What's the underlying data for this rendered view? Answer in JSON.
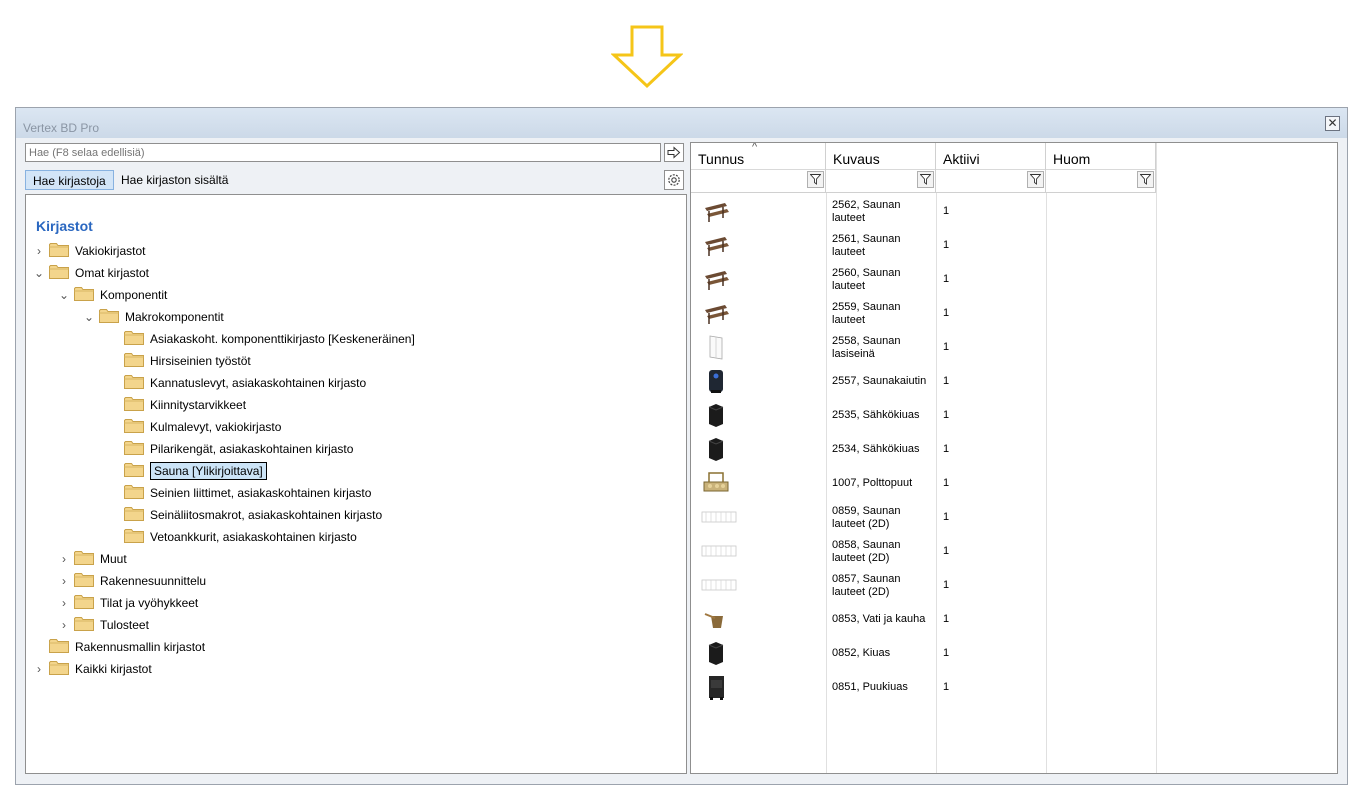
{
  "window": {
    "title": "Vertex BD Pro",
    "close_glyph": "✕"
  },
  "search": {
    "placeholder": "Hae (F8 selaa edellisiä)"
  },
  "tabs": {
    "search_libraries": "Hae kirjastoja",
    "search_library_content": "Hae kirjaston sisältä"
  },
  "tree": {
    "title": "Kirjastot",
    "nodes": [
      {
        "label": "Vakiokirjastot",
        "expander": "›"
      },
      {
        "label": "Omat kirjastot",
        "expander": "⌄"
      },
      {
        "label": "Komponentit",
        "expander": "⌄"
      },
      {
        "label": "Makrokomponentit",
        "expander": "⌄"
      },
      {
        "label": "Asiakaskoht. komponenttikirjasto  [Keskeneräinen]",
        "expander": ""
      },
      {
        "label": "Hirsiseinien työstöt",
        "expander": ""
      },
      {
        "label": "Kannatuslevyt, asiakaskohtainen kirjasto",
        "expander": ""
      },
      {
        "label": "Kiinnitystarvikkeet",
        "expander": ""
      },
      {
        "label": "Kulmalevyt, vakiokirjasto",
        "expander": ""
      },
      {
        "label": "Pilarikengät, asiakaskohtainen kirjasto",
        "expander": ""
      },
      {
        "label": "Sauna  [Ylikirjoittava]",
        "expander": ""
      },
      {
        "label": "Seinien liittimet, asiakaskohtainen kirjasto",
        "expander": ""
      },
      {
        "label": "Seinäliitosmakrot, asiakaskohtainen kirjasto",
        "expander": ""
      },
      {
        "label": "Vetoankkurit, asiakaskohtainen kirjasto",
        "expander": ""
      },
      {
        "label": "Muut",
        "expander": "›"
      },
      {
        "label": "Rakennesuunnittelu",
        "expander": "›"
      },
      {
        "label": "Tilat ja vyöhykkeet",
        "expander": "›"
      },
      {
        "label": "Tulosteet",
        "expander": "›"
      },
      {
        "label": "Rakennusmallin kirjastot",
        "expander": ""
      },
      {
        "label": "Kaikki kirjastot",
        "expander": "›"
      }
    ]
  },
  "grid": {
    "columns": [
      "Tunnus",
      "Kuvaus",
      "Aktiivi",
      "Huom"
    ],
    "sort_indicator": "^",
    "rows": [
      {
        "line1": "2562, Saunan",
        "line2": "lauteet",
        "active": "1",
        "icon": "bench-icon"
      },
      {
        "line1": "2561, Saunan",
        "line2": "lauteet",
        "active": "1",
        "icon": "bench-icon"
      },
      {
        "line1": "2560, Saunan",
        "line2": "lauteet",
        "active": "1",
        "icon": "bench-icon"
      },
      {
        "line1": "2559, Saunan",
        "line2": "lauteet",
        "active": "1",
        "icon": "bench-icon"
      },
      {
        "line1": "2558, Saunan",
        "line2": "lasiseinä",
        "active": "1",
        "icon": "glass-wall-icon"
      },
      {
        "line1": "2557, Saunakaiutin",
        "line2": "",
        "active": "1",
        "icon": "speaker-icon"
      },
      {
        "line1": "2535, Sähkökiuas",
        "line2": "",
        "active": "1",
        "icon": "stove-icon"
      },
      {
        "line1": "2534, Sähkökiuas",
        "line2": "",
        "active": "1",
        "icon": "stove-icon"
      },
      {
        "line1": "1007, Polttopuut",
        "line2": "",
        "active": "1",
        "icon": "firewood-icon"
      },
      {
        "line1": "0859, Saunan",
        "line2": "lauteet (2D)",
        "active": "1",
        "icon": "bench-2d-icon"
      },
      {
        "line1": "0858, Saunan",
        "line2": "lauteet (2D)",
        "active": "1",
        "icon": "bench-2d-icon"
      },
      {
        "line1": "0857, Saunan",
        "line2": "lauteet (2D)",
        "active": "1",
        "icon": "bench-2d-icon"
      },
      {
        "line1": "0853, Vati ja kauha",
        "line2": "",
        "active": "1",
        "icon": "bucket-icon"
      },
      {
        "line1": "0852, Kiuas",
        "line2": "",
        "active": "1",
        "icon": "stove-icon"
      },
      {
        "line1": "0851, Puukiuas",
        "line2": "",
        "active": "1",
        "icon": "wood-stove-icon"
      }
    ]
  },
  "colors": {
    "accent": "#2a67c0",
    "arrow": "#f5c518",
    "selected_bg": "#cce4f7"
  }
}
